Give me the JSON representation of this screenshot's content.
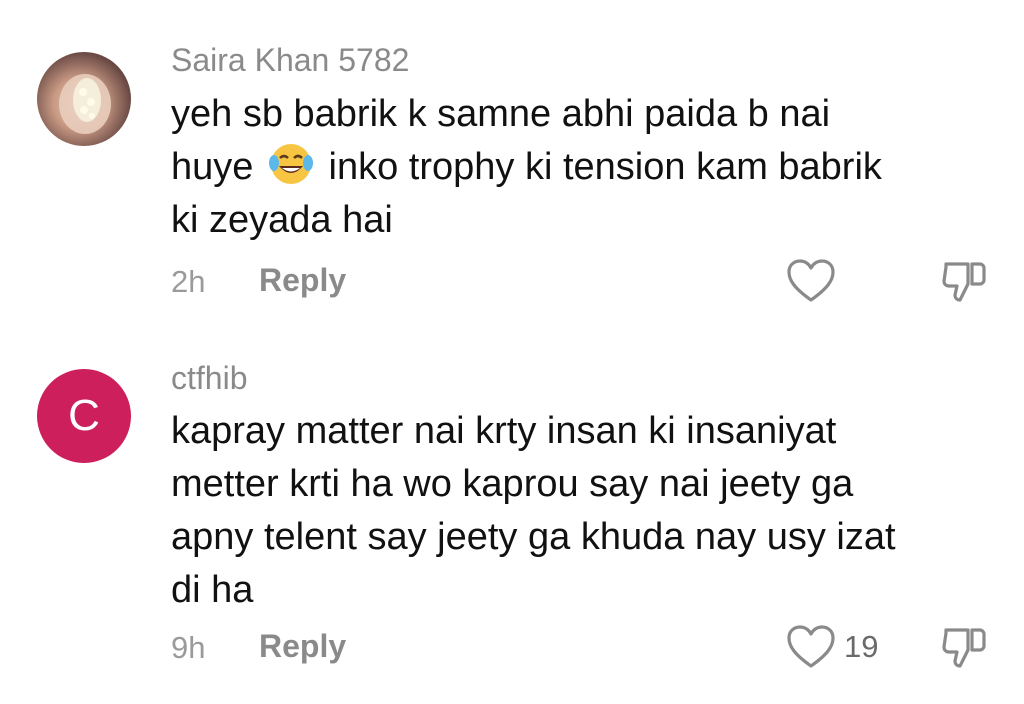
{
  "comments": [
    {
      "username": "Saira Khan 5782",
      "avatar_type": "photo",
      "text_line1": "yeh sb babrik k samne abhi paida b nai",
      "text_line2_pre": "huye",
      "emoji": "face-with-tears-of-joy",
      "text_line2_post": "inko trophy ki tension kam babrik",
      "text_line3": "ki zeyada hai",
      "time": "2h",
      "reply_label": "Reply",
      "like_count": ""
    },
    {
      "username": "ctfhib",
      "avatar_type": "letter",
      "avatar_letter": "C",
      "avatar_color": "#cc1f5c",
      "text_line1": "kapray matter nai krty insan ki insaniyat",
      "text_line2": "metter krti ha wo kaprou say nai jeety ga",
      "text_line3": "apny telent say jeety ga khuda nay usy izat",
      "text_line4": "di ha",
      "time": "9h",
      "reply_label": "Reply",
      "like_count": "19"
    }
  ],
  "icons": {
    "like": "heart-outline-icon",
    "dislike": "thumbs-down-outline-icon"
  }
}
